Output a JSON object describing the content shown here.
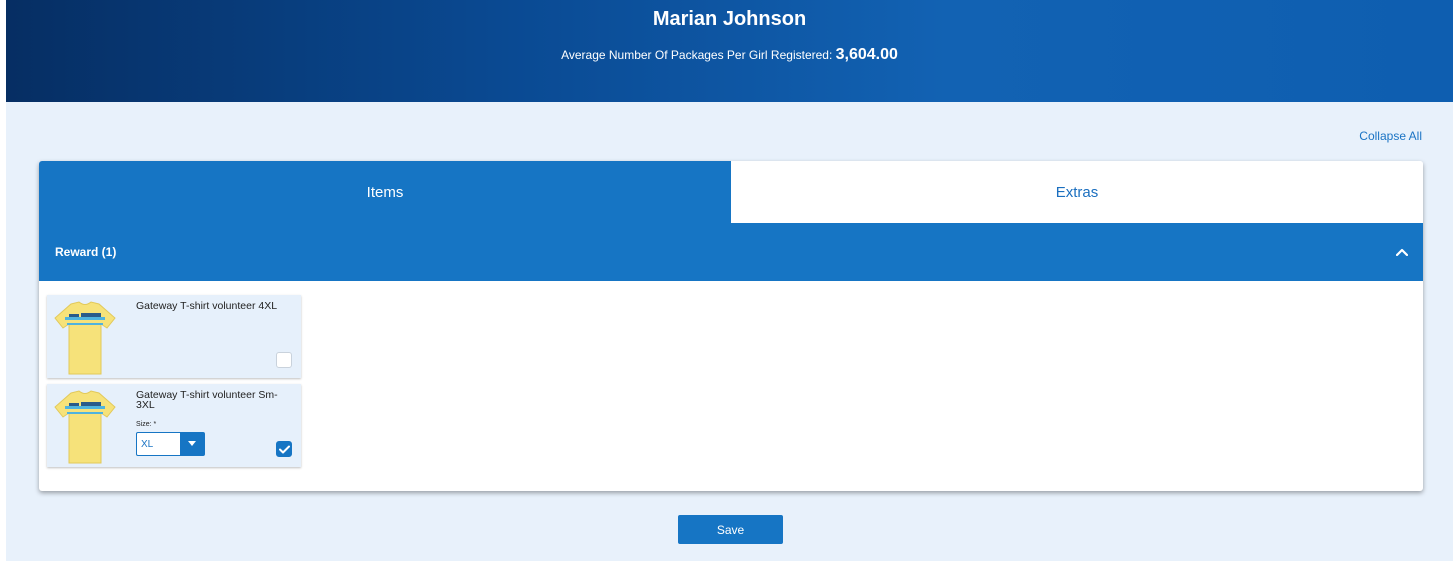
{
  "header": {
    "name": "Marian Johnson",
    "stat_label": "Average Number Of Packages Per Girl Registered:",
    "stat_value": "3,604.00"
  },
  "collapse_all_label": "Collapse All",
  "tabs": [
    {
      "label": "Items",
      "active": true
    },
    {
      "label": "Extras",
      "active": false
    }
  ],
  "section": {
    "title": "Reward (1)",
    "toggle_icon": "chevron-up-icon"
  },
  "items": [
    {
      "name": "Gateway T-shirt volunteer 4XL",
      "checked": false
    },
    {
      "name": "Gateway T-shirt volunteer Sm-3XL",
      "size_label": "Size: *",
      "size_value": "XL",
      "checked": true
    }
  ],
  "save_label": "Save",
  "colors": {
    "primary": "#1675c4",
    "background": "#e8f1fb",
    "shirt": "#f6e27a"
  }
}
